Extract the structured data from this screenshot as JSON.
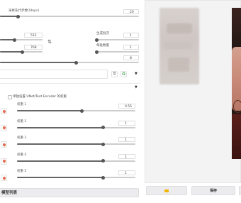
{
  "steps": {
    "label": "采样迭代步数(Steps)",
    "value": "20",
    "fill": 0.13
  },
  "width": {
    "value": "512",
    "fill": 0.34
  },
  "height": {
    "value": "768",
    "fill": 0.52
  },
  "swap_icon": "swap-arrows-icon",
  "batch_count": {
    "label": "生成批次",
    "value": "1",
    "fill": 0.0
  },
  "batch_size": {
    "label": "每批数量",
    "value": "1",
    "fill": 0.0
  },
  "cfg": {
    "value": "8",
    "fill": 0.55
  },
  "prompt_tools": {
    "paste_icon": "paste-icon",
    "recycle_icon": "recycle-icon",
    "arrow": "▼"
  },
  "lora_section": {
    "collapse_arrow": "▼",
    "checkbox_label": "单独设置 UNet/Text Encoder 的权重",
    "rows": [
      {
        "label": "权重 1",
        "value": "0.55",
        "fill": 0.55
      },
      {
        "label": "权重 2",
        "value": "1",
        "fill": 0.73
      },
      {
        "label": "权重 3",
        "value": "1",
        "fill": 0.73
      },
      {
        "label": "权重 4",
        "value": "1",
        "fill": 0.73
      },
      {
        "label": "权重 5",
        "value": "1",
        "fill": 0.73
      }
    ],
    "footer_button": "模型列表"
  },
  "output": {
    "folder_icon": "folder-icon",
    "save_label": "保存"
  },
  "colors": {
    "accent": "#e46a4f",
    "slider": "#666666",
    "panel": "#f7f7f8"
  }
}
